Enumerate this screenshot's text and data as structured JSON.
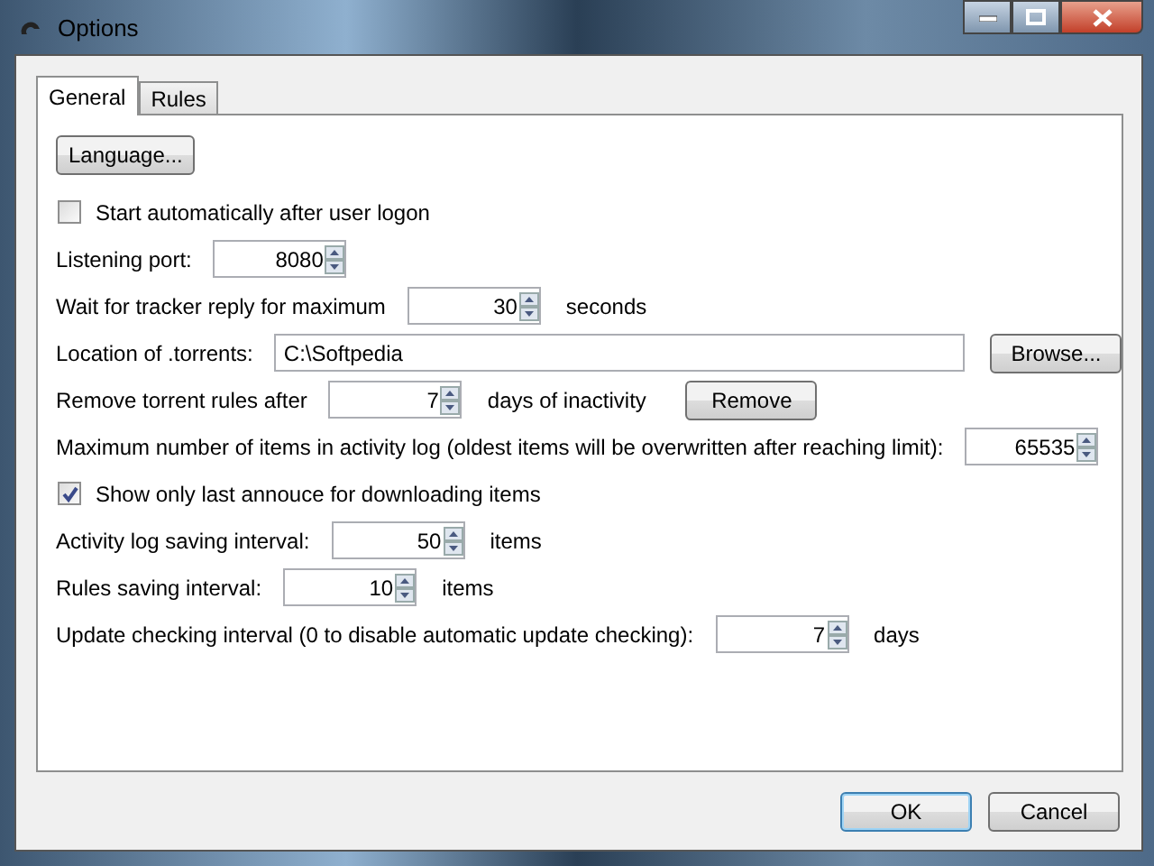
{
  "window": {
    "title": "Options"
  },
  "tabs": [
    {
      "label": "General",
      "selected": true
    },
    {
      "label": "Rules",
      "selected": false
    }
  ],
  "rows": [
    {
      "kind": "button",
      "button": "Language..."
    },
    {
      "kind": "checkbox",
      "label": "Start automatically after user logon",
      "checked": false
    },
    {
      "kind": "spin",
      "label": "Listening port:",
      "value": "8080"
    },
    {
      "kind": "spin",
      "label": "Wait for tracker reply for maximum",
      "value": "30",
      "suffix": "seconds"
    },
    {
      "kind": "path",
      "label": "Location of .torrents:",
      "value": "C:\\Softpedia",
      "button": "Browse..."
    },
    {
      "kind": "spin",
      "label": "Remove torrent rules after",
      "value": "7",
      "suffix": "days of inactivity",
      "button": "Remove"
    },
    {
      "kind": "spin",
      "label": "Maximum number of items in activity log (oldest items will be overwritten after reaching limit):",
      "value": "65535"
    },
    {
      "kind": "checkbox",
      "label": "Show only last annouce for downloading items",
      "checked": true
    },
    {
      "kind": "spin",
      "label": "Activity log saving interval:",
      "value": "50",
      "suffix": "items"
    },
    {
      "kind": "spin",
      "label": "Rules saving interval:",
      "value": "10",
      "suffix": "items"
    },
    {
      "kind": "spin",
      "label": "Update checking interval (0 to disable automatic update checking):",
      "value": "7",
      "suffix": "days"
    }
  ],
  "buttons": [
    "OK",
    "Cancel"
  ]
}
